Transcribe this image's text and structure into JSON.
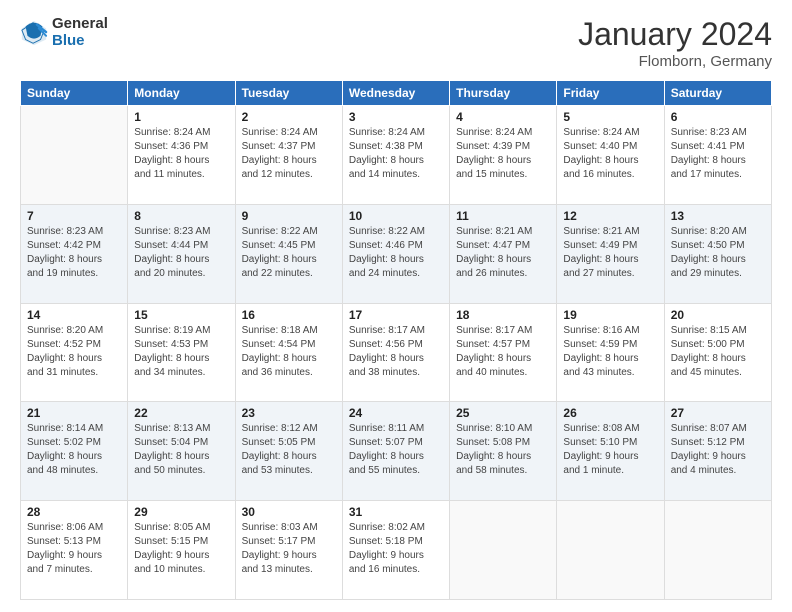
{
  "header": {
    "logo": {
      "general": "General",
      "blue": "Blue"
    },
    "title": "January 2024",
    "location": "Flomborn, Germany"
  },
  "calendar": {
    "days_of_week": [
      "Sunday",
      "Monday",
      "Tuesday",
      "Wednesday",
      "Thursday",
      "Friday",
      "Saturday"
    ],
    "weeks": [
      [
        {
          "day": "",
          "sunrise": "",
          "sunset": "",
          "daylight": ""
        },
        {
          "day": "1",
          "sunrise": "Sunrise: 8:24 AM",
          "sunset": "Sunset: 4:36 PM",
          "daylight": "Daylight: 8 hours and 11 minutes."
        },
        {
          "day": "2",
          "sunrise": "Sunrise: 8:24 AM",
          "sunset": "Sunset: 4:37 PM",
          "daylight": "Daylight: 8 hours and 12 minutes."
        },
        {
          "day": "3",
          "sunrise": "Sunrise: 8:24 AM",
          "sunset": "Sunset: 4:38 PM",
          "daylight": "Daylight: 8 hours and 14 minutes."
        },
        {
          "day": "4",
          "sunrise": "Sunrise: 8:24 AM",
          "sunset": "Sunset: 4:39 PM",
          "daylight": "Daylight: 8 hours and 15 minutes."
        },
        {
          "day": "5",
          "sunrise": "Sunrise: 8:24 AM",
          "sunset": "Sunset: 4:40 PM",
          "daylight": "Daylight: 8 hours and 16 minutes."
        },
        {
          "day": "6",
          "sunrise": "Sunrise: 8:23 AM",
          "sunset": "Sunset: 4:41 PM",
          "daylight": "Daylight: 8 hours and 17 minutes."
        }
      ],
      [
        {
          "day": "7",
          "sunrise": "Sunrise: 8:23 AM",
          "sunset": "Sunset: 4:42 PM",
          "daylight": "Daylight: 8 hours and 19 minutes."
        },
        {
          "day": "8",
          "sunrise": "Sunrise: 8:23 AM",
          "sunset": "Sunset: 4:44 PM",
          "daylight": "Daylight: 8 hours and 20 minutes."
        },
        {
          "day": "9",
          "sunrise": "Sunrise: 8:22 AM",
          "sunset": "Sunset: 4:45 PM",
          "daylight": "Daylight: 8 hours and 22 minutes."
        },
        {
          "day": "10",
          "sunrise": "Sunrise: 8:22 AM",
          "sunset": "Sunset: 4:46 PM",
          "daylight": "Daylight: 8 hours and 24 minutes."
        },
        {
          "day": "11",
          "sunrise": "Sunrise: 8:21 AM",
          "sunset": "Sunset: 4:47 PM",
          "daylight": "Daylight: 8 hours and 26 minutes."
        },
        {
          "day": "12",
          "sunrise": "Sunrise: 8:21 AM",
          "sunset": "Sunset: 4:49 PM",
          "daylight": "Daylight: 8 hours and 27 minutes."
        },
        {
          "day": "13",
          "sunrise": "Sunrise: 8:20 AM",
          "sunset": "Sunset: 4:50 PM",
          "daylight": "Daylight: 8 hours and 29 minutes."
        }
      ],
      [
        {
          "day": "14",
          "sunrise": "Sunrise: 8:20 AM",
          "sunset": "Sunset: 4:52 PM",
          "daylight": "Daylight: 8 hours and 31 minutes."
        },
        {
          "day": "15",
          "sunrise": "Sunrise: 8:19 AM",
          "sunset": "Sunset: 4:53 PM",
          "daylight": "Daylight: 8 hours and 34 minutes."
        },
        {
          "day": "16",
          "sunrise": "Sunrise: 8:18 AM",
          "sunset": "Sunset: 4:54 PM",
          "daylight": "Daylight: 8 hours and 36 minutes."
        },
        {
          "day": "17",
          "sunrise": "Sunrise: 8:17 AM",
          "sunset": "Sunset: 4:56 PM",
          "daylight": "Daylight: 8 hours and 38 minutes."
        },
        {
          "day": "18",
          "sunrise": "Sunrise: 8:17 AM",
          "sunset": "Sunset: 4:57 PM",
          "daylight": "Daylight: 8 hours and 40 minutes."
        },
        {
          "day": "19",
          "sunrise": "Sunrise: 8:16 AM",
          "sunset": "Sunset: 4:59 PM",
          "daylight": "Daylight: 8 hours and 43 minutes."
        },
        {
          "day": "20",
          "sunrise": "Sunrise: 8:15 AM",
          "sunset": "Sunset: 5:00 PM",
          "daylight": "Daylight: 8 hours and 45 minutes."
        }
      ],
      [
        {
          "day": "21",
          "sunrise": "Sunrise: 8:14 AM",
          "sunset": "Sunset: 5:02 PM",
          "daylight": "Daylight: 8 hours and 48 minutes."
        },
        {
          "day": "22",
          "sunrise": "Sunrise: 8:13 AM",
          "sunset": "Sunset: 5:04 PM",
          "daylight": "Daylight: 8 hours and 50 minutes."
        },
        {
          "day": "23",
          "sunrise": "Sunrise: 8:12 AM",
          "sunset": "Sunset: 5:05 PM",
          "daylight": "Daylight: 8 hours and 53 minutes."
        },
        {
          "day": "24",
          "sunrise": "Sunrise: 8:11 AM",
          "sunset": "Sunset: 5:07 PM",
          "daylight": "Daylight: 8 hours and 55 minutes."
        },
        {
          "day": "25",
          "sunrise": "Sunrise: 8:10 AM",
          "sunset": "Sunset: 5:08 PM",
          "daylight": "Daylight: 8 hours and 58 minutes."
        },
        {
          "day": "26",
          "sunrise": "Sunrise: 8:08 AM",
          "sunset": "Sunset: 5:10 PM",
          "daylight": "Daylight: 9 hours and 1 minute."
        },
        {
          "day": "27",
          "sunrise": "Sunrise: 8:07 AM",
          "sunset": "Sunset: 5:12 PM",
          "daylight": "Daylight: 9 hours and 4 minutes."
        }
      ],
      [
        {
          "day": "28",
          "sunrise": "Sunrise: 8:06 AM",
          "sunset": "Sunset: 5:13 PM",
          "daylight": "Daylight: 9 hours and 7 minutes."
        },
        {
          "day": "29",
          "sunrise": "Sunrise: 8:05 AM",
          "sunset": "Sunset: 5:15 PM",
          "daylight": "Daylight: 9 hours and 10 minutes."
        },
        {
          "day": "30",
          "sunrise": "Sunrise: 8:03 AM",
          "sunset": "Sunset: 5:17 PM",
          "daylight": "Daylight: 9 hours and 13 minutes."
        },
        {
          "day": "31",
          "sunrise": "Sunrise: 8:02 AM",
          "sunset": "Sunset: 5:18 PM",
          "daylight": "Daylight: 9 hours and 16 minutes."
        },
        {
          "day": "",
          "sunrise": "",
          "sunset": "",
          "daylight": ""
        },
        {
          "day": "",
          "sunrise": "",
          "sunset": "",
          "daylight": ""
        },
        {
          "day": "",
          "sunrise": "",
          "sunset": "",
          "daylight": ""
        }
      ]
    ]
  }
}
